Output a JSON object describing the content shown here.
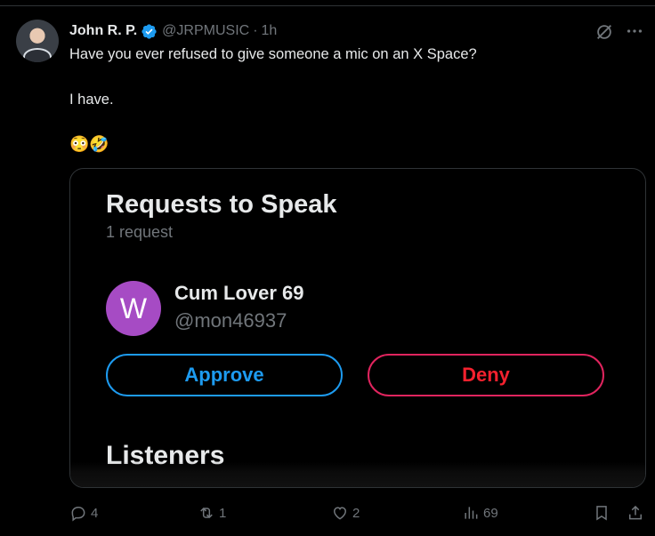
{
  "tweet": {
    "author_name": "John R. P.",
    "handle": "@JRPMUSIC",
    "separator": "·",
    "time": "1h",
    "text_line1": "Have you ever refused to give someone a mic on an X Space?",
    "text_line2": "I have.",
    "text_line3": "😳🤣"
  },
  "card": {
    "title": "Requests to Speak",
    "count": "1 request",
    "requester_initial": "W",
    "requester_name": "Cum Lover 69",
    "requester_handle": "@mon46937",
    "approve_label": "Approve",
    "deny_label": "Deny",
    "listeners_title": "Listeners"
  },
  "actions": {
    "replies": "4",
    "reposts": "1",
    "likes": "2",
    "views": "69"
  },
  "colors": {
    "accent_blue": "#1d9bf0",
    "deny_red": "#f4212e",
    "avatar_purple": "#a64bc4",
    "muted": "#71767b"
  }
}
